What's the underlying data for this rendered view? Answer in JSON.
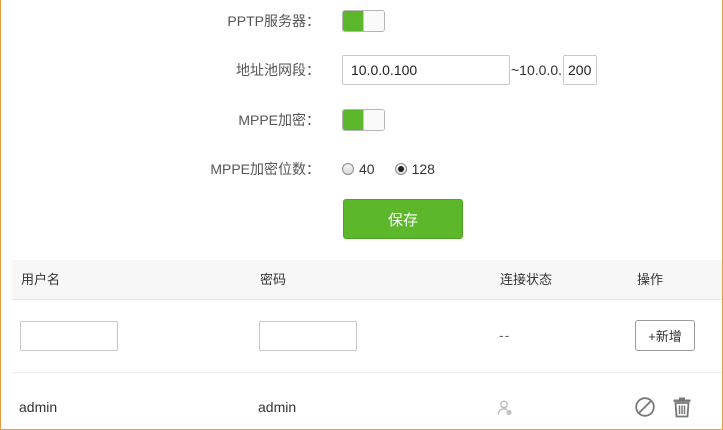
{
  "form": {
    "pptp_server": {
      "label": "PPTP服务器：",
      "enabled": true
    },
    "address_pool": {
      "label": "地址池网段：",
      "start_value": "10.0.0.100",
      "separator": "~10.0.0.",
      "end_value": "200"
    },
    "mppe_encryption": {
      "label": "MPPE加密：",
      "enabled": true
    },
    "mppe_bits": {
      "label": "MPPE加密位数：",
      "options": [
        {
          "label": "40",
          "checked": false
        },
        {
          "label": "128",
          "checked": true
        }
      ]
    },
    "save_label": "保存"
  },
  "table": {
    "headers": {
      "username": "用户名",
      "password": "密码",
      "status": "连接状态",
      "actions": "操作"
    },
    "add_row": {
      "username_value": "",
      "password_value": "",
      "status_text": "--",
      "add_label": "+新增"
    },
    "users": [
      {
        "username": "admin",
        "password": "admin",
        "status_icon": "user-offline-icon"
      }
    ]
  },
  "colors": {
    "accent_green": "#5cb82a",
    "frame_border": "#e7a040"
  }
}
